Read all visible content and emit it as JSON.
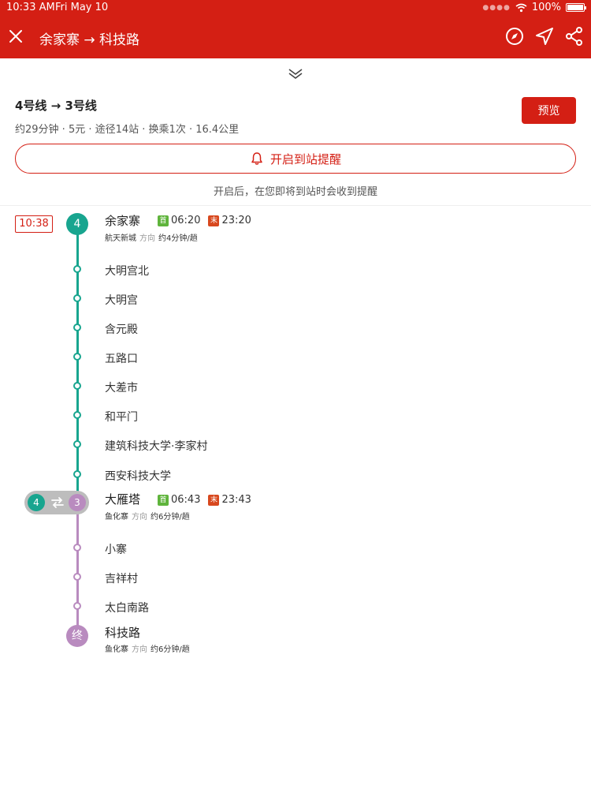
{
  "status_bar": {
    "time": "10:33 AM",
    "date": "Fri May 10",
    "battery": "100%"
  },
  "nav": {
    "title": "余家寨 → 科技路"
  },
  "summary": {
    "title": "4号线 → 3号线",
    "subtitle": "约29分钟 · 5元 · 途径14站 · 换乘1次 · 16.4公里",
    "preview_label": "预览",
    "reminder_label": "开启到站提醒",
    "reminder_note": "开启后，在您即将到站时会收到提醒"
  },
  "route": {
    "departure_time": "10:38",
    "start": {
      "line": "4",
      "name": "余家寨",
      "first_tag": "首",
      "first_time": "06:20",
      "last_tag": "末",
      "last_time": "23:20",
      "direction": "航天新城",
      "direction_word": "方向",
      "frequency": "约4分钟/趟"
    },
    "stops_line4": [
      "大明宫北",
      "大明宫",
      "含元殿",
      "五路口",
      "大差市",
      "和平门",
      "建筑科技大学·李家村",
      "西安科技大学"
    ],
    "transfer": {
      "from_line": "4",
      "to_line": "3",
      "name": "大雁塔",
      "first_tag": "首",
      "first_time": "06:43",
      "last_tag": "末",
      "last_time": "23:43",
      "direction": "鱼化寨",
      "direction_word": "方向",
      "frequency": "约6分钟/趟"
    },
    "stops_line3": [
      "小寨",
      "吉祥村",
      "太白南路"
    ],
    "end": {
      "badge": "终",
      "name": "科技路",
      "direction": "鱼化寨",
      "direction_word": "方向",
      "frequency": "约6分钟/趟"
    }
  },
  "colors": {
    "brand_red": "#d41f14",
    "line4": "#18a58f",
    "line3": "#b98bbf"
  }
}
